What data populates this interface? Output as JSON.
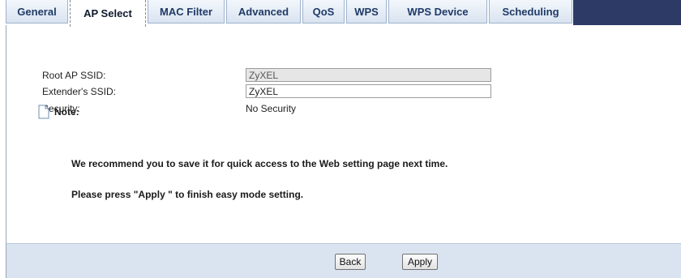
{
  "tabs": [
    {
      "label": "General",
      "active": false
    },
    {
      "label": "AP Select",
      "active": true
    },
    {
      "label": "MAC Filter",
      "active": false
    },
    {
      "label": "Advanced",
      "active": false
    },
    {
      "label": "QoS",
      "active": false
    },
    {
      "label": "WPS",
      "active": false
    },
    {
      "label": "WPS Device",
      "active": false
    },
    {
      "label": "Scheduling",
      "active": false
    }
  ],
  "form": {
    "root_ap_ssid": {
      "label": "Root AP SSID:",
      "value": "ZyXEL"
    },
    "extender_ssid": {
      "label": "Extender's SSID:",
      "value": "ZyXEL"
    },
    "security": {
      "label": "Security:",
      "value": "No Security"
    }
  },
  "note": {
    "icon": "document-icon",
    "title": "Note:",
    "lines": [
      "We recommend you to save it for quick access to the Web setting page next time.",
      "Please press \"Apply \" to finish easy mode setting."
    ]
  },
  "buttons": {
    "back": "Back",
    "apply": "Apply"
  },
  "colors": {
    "tab_bar_fill": "#2d3a66",
    "tab_text": "#1f3a66",
    "footer_bg": "#dae4f0",
    "readonly_field_bg": "#e6e6e6"
  }
}
